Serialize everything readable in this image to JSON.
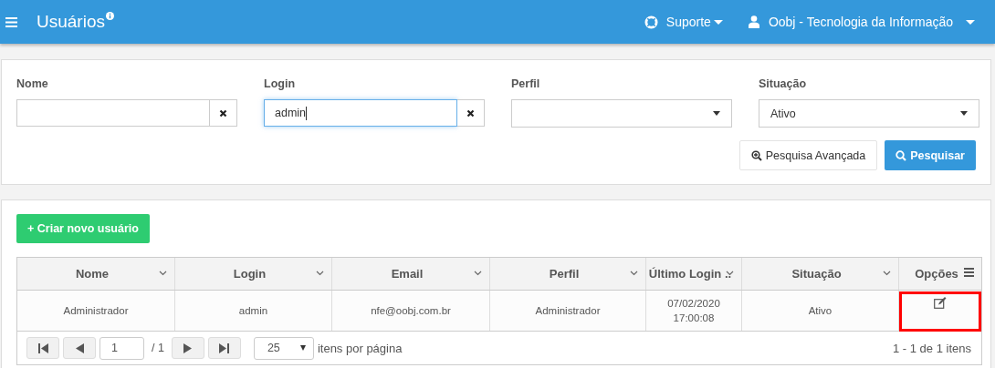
{
  "header": {
    "title": "Usuários",
    "support": "Suporte",
    "user": "Oobj - Tecnologia da Informação"
  },
  "filters": [
    {
      "label": "Nome",
      "kind": "text",
      "focused": false
    },
    {
      "label": "Login",
      "kind": "text",
      "value": "admin",
      "focused": true
    },
    {
      "label": "Perfil",
      "kind": "select"
    },
    {
      "label": "Situação",
      "kind": "select",
      "value": "Ativo"
    }
  ],
  "buttons": {
    "advanced": "Pesquisa Avançada",
    "search": "Pesquisar",
    "create": "+ Criar novo usuário"
  },
  "table": {
    "columns": [
      "Nome",
      "Login",
      "Email",
      "Perfil",
      "Último Login ..",
      "Situação",
      "Opções"
    ],
    "rows": [
      {
        "cells": [
          "Administrador",
          "admin",
          "nfe@oobj.com.br",
          "Administrador",
          "07/02/2020\n17:00:08",
          "Ativo"
        ]
      }
    ]
  },
  "pager": {
    "page": "1",
    "of": "/ 1",
    "size": "25",
    "size_label": "itens por página",
    "summary": "1 - 1 de 1 itens"
  }
}
